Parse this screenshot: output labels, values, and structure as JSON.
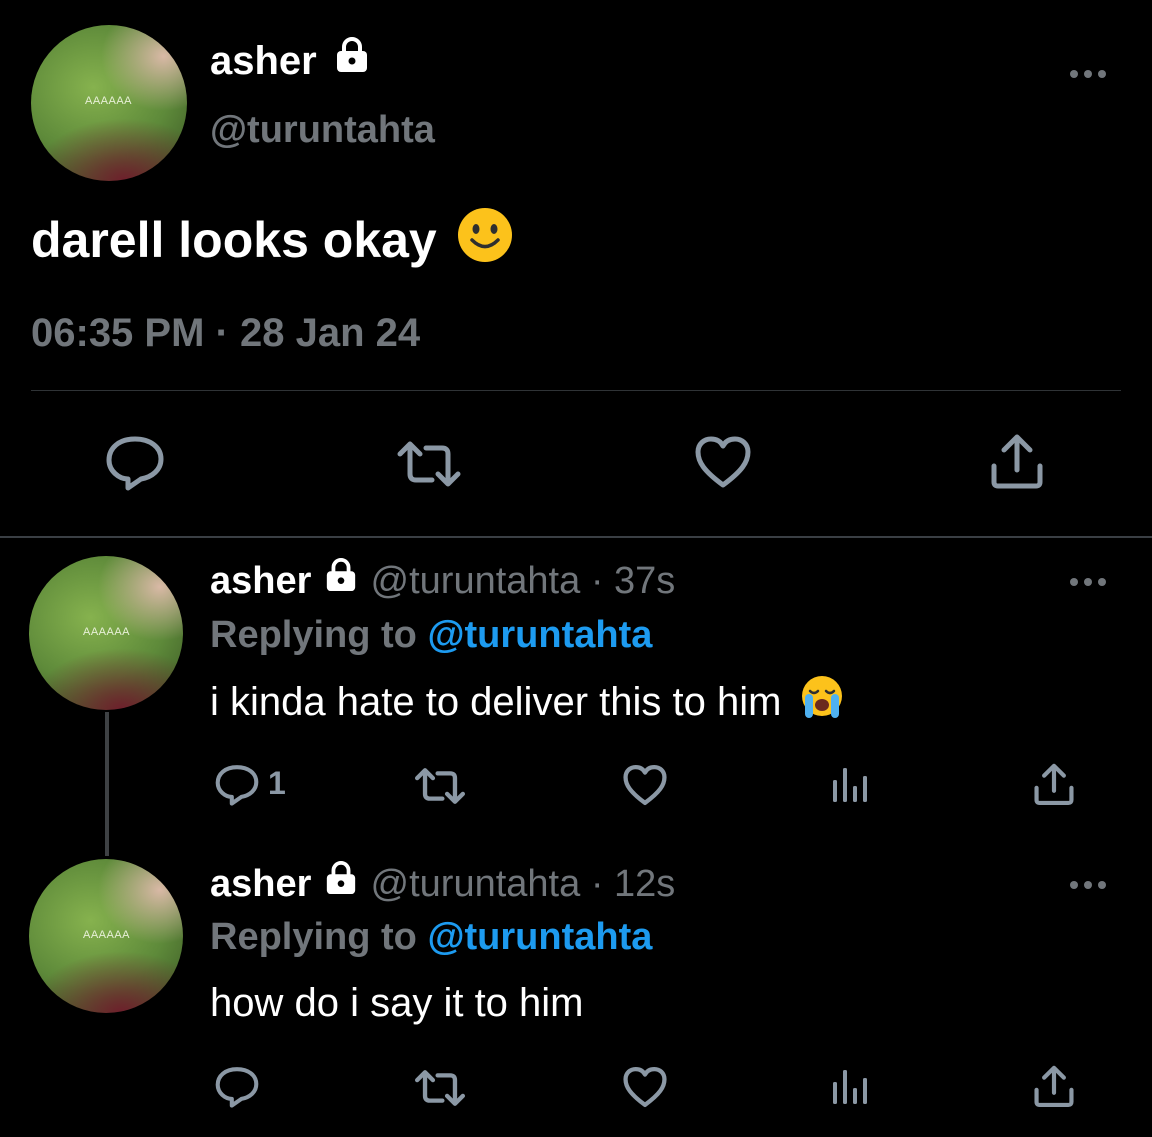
{
  "main_tweet": {
    "display_name": "asher",
    "handle": "@turuntahta",
    "text": "darell looks okay",
    "emoji": "slightly-smiling-face",
    "avatar_caption": "AAAAAA",
    "timestamp": "06:35 PM · 28 Jan 24",
    "actions": [
      "reply-icon",
      "retweet-icon",
      "like-icon",
      "share-icon"
    ]
  },
  "replies": [
    {
      "display_name": "asher",
      "handle": "@turuntahta",
      "separator": "·",
      "time_ago": "37s",
      "replying_prefix": "Replying to",
      "replying_handle": "@turuntahta",
      "text": "i kinda hate to deliver this to him",
      "emoji": "loudly-crying-face",
      "avatar_caption": "AAAAAA",
      "reply_count": "1"
    },
    {
      "display_name": "asher",
      "handle": "@turuntahta",
      "separator": "·",
      "time_ago": "12s",
      "replying_prefix": "Replying to",
      "replying_handle": "@turuntahta",
      "text": "how do i say it to him",
      "avatar_caption": "AAAAAA",
      "reply_count": ""
    }
  ],
  "colors": {
    "background": "#000000",
    "text": "#e7e9ea",
    "secondary": "#71767b",
    "accent": "#1d9bf0",
    "divider": "#2f3336"
  }
}
